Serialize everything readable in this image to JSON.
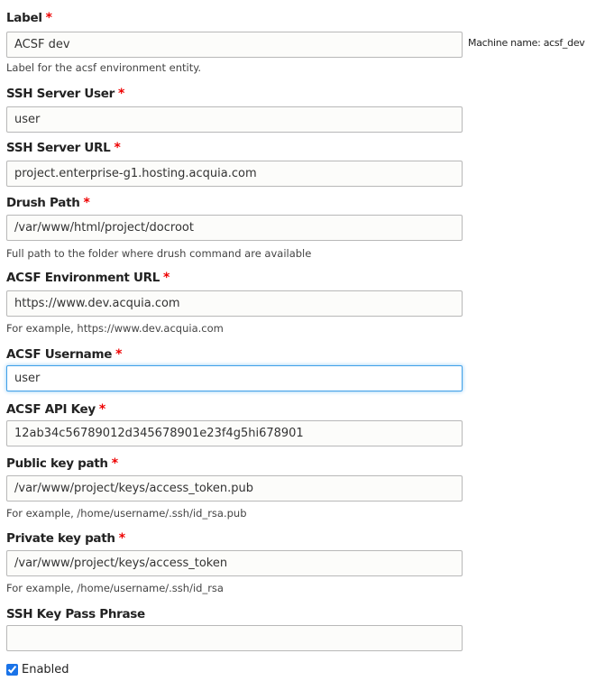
{
  "fields": [
    {
      "label": "Label",
      "required": true,
      "value": "ACSF dev",
      "desc": "Label for the acsf environment entity."
    },
    {
      "label": "SSH Server User",
      "required": true,
      "value": "user"
    },
    {
      "label": "SSH Server URL",
      "required": true,
      "value": "project.enterprise-g1.hosting.acquia.com"
    },
    {
      "label": "Drush Path",
      "required": true,
      "value": "/var/www/html/project/docroot",
      "desc": "Full path to the folder where drush command are available"
    },
    {
      "label": "ACSF Environment URL",
      "required": true,
      "value": "https://www.dev.acquia.com",
      "desc": "For example, https://www.dev.acquia.com"
    },
    {
      "label": "ACSF Username",
      "required": true,
      "value": "user"
    },
    {
      "label": "ACSF API Key",
      "required": true,
      "value": "12ab34c56789012d345678901e23f4g5hi678901"
    },
    {
      "label": "Public key path",
      "required": true,
      "value": "/var/www/project/keys/access_token.pub",
      "desc": "For example, /home/username/.ssh/id_rsa.pub"
    },
    {
      "label": "Private key path",
      "required": true,
      "value": "/var/www/project/keys/access_token",
      "desc": "For example, /home/username/.ssh/id_rsa"
    },
    {
      "label": "SSH Key Pass Phrase",
      "required": false,
      "value": ""
    }
  ],
  "machine_name": "Machine name: acsf_dev",
  "required_marker": "*",
  "enabled": {
    "label": "Enabled",
    "checked": true
  }
}
